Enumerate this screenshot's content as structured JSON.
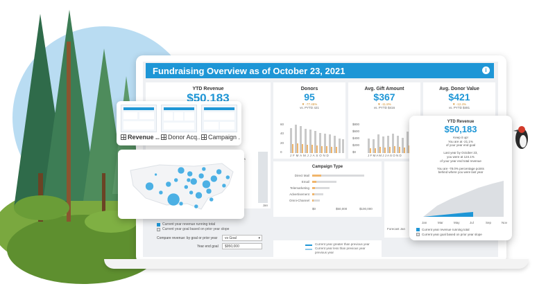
{
  "dashboard": {
    "title": "Fundraising Overview as of October 23, 2021",
    "ytd_revenue": {
      "title": "YTD Revenue",
      "value": "$50,183",
      "note_line1": "You are -78.0% percentage points",
      "note_line2": "behind where you were last year"
    },
    "donors": {
      "title": "Donors",
      "value": "95",
      "change": "▼ -77.45%",
      "vs": "vs. PYTD 421",
      "yticks": [
        "60",
        "40",
        "20",
        "0"
      ],
      "months": "JFMAMJJASOND",
      "bars": [
        52,
        58,
        55,
        50,
        48,
        45,
        42,
        40,
        38,
        35,
        30,
        28
      ]
    },
    "avg_gift": {
      "title": "Avg. Gift Amount",
      "value": "$367",
      "change": "▼ -11.8%",
      "vs": "vs. PYTD $416",
      "yticks": [
        "$800",
        "$600",
        "$400",
        "$200",
        "$0"
      ],
      "months": "J F M A M J J A S O N D",
      "bars": [
        30,
        28,
        38,
        34,
        36,
        40,
        35,
        32,
        44,
        38,
        42,
        48
      ]
    },
    "avg_donor": {
      "title": "Avg. Donor Value",
      "value": "$421",
      "change": "▼ -12.4%",
      "vs": "vs. PYTD $481"
    },
    "campaign": {
      "title": "Campaign Type",
      "rows": [
        {
          "label": "Direct Mail",
          "value": 85
        },
        {
          "label": "Email",
          "value": 40
        },
        {
          "label": "Telemarketing",
          "value": 28
        },
        {
          "label": "Advertisement",
          "value": 18
        },
        {
          "label": "Omni-Channel",
          "value": 12
        }
      ],
      "xticks": [
        "$0",
        "$50,000",
        "$100,000"
      ]
    },
    "legend": {
      "item1": "Current year revenue running total",
      "item2": "Current year goal based on prior year slope"
    },
    "controls": {
      "compare_label": "Compare revenue: by goal or prior year",
      "compare_value": "vs Goal",
      "year_goal_label": "Year end goal",
      "year_goal_value": "$950,000"
    },
    "bottom_legend": {
      "line1": "Current year greater than previous year",
      "line2": "Current year less than previous year",
      "line3": "previous year"
    },
    "axis_end": "Jan",
    "axis_small": "Forecast Jan"
  },
  "thumbnails": [
    {
      "label": "Revenue ..."
    },
    {
      "label": "Donor Acq..."
    },
    {
      "label": "Campaign ..."
    }
  ],
  "map": {
    "points": [
      {
        "x": 0.44,
        "y": 0.72,
        "r": 9
      },
      {
        "x": 0.25,
        "y": 0.53,
        "r": 6
      },
      {
        "x": 0.4,
        "y": 0.5,
        "r": 4
      },
      {
        "x": 0.5,
        "y": 0.3,
        "r": 5
      },
      {
        "x": 0.57,
        "y": 0.35,
        "r": 4
      },
      {
        "x": 0.54,
        "y": 0.54,
        "r": 3
      },
      {
        "x": 0.6,
        "y": 0.46,
        "r": 5
      },
      {
        "x": 0.66,
        "y": 0.38,
        "r": 4
      },
      {
        "x": 0.7,
        "y": 0.5,
        "r": 6
      },
      {
        "x": 0.76,
        "y": 0.42,
        "r": 5
      },
      {
        "x": 0.8,
        "y": 0.32,
        "r": 4
      },
      {
        "x": 0.72,
        "y": 0.6,
        "r": 4
      },
      {
        "x": 0.64,
        "y": 0.66,
        "r": 5
      },
      {
        "x": 0.58,
        "y": 0.62,
        "r": 3
      },
      {
        "x": 0.84,
        "y": 0.52,
        "r": 3
      },
      {
        "x": 0.62,
        "y": 0.82,
        "r": 3
      },
      {
        "x": 0.5,
        "y": 0.78,
        "r": 3
      },
      {
        "x": 0.34,
        "y": 0.62,
        "r": 3
      },
      {
        "x": 0.3,
        "y": 0.36,
        "r": 2
      },
      {
        "x": 0.46,
        "y": 0.44,
        "r": 3
      },
      {
        "x": 0.68,
        "y": 0.28,
        "r": 3
      },
      {
        "x": 0.87,
        "y": 0.4,
        "r": 3
      },
      {
        "x": 0.74,
        "y": 0.72,
        "r": 3
      },
      {
        "x": 0.56,
        "y": 0.44,
        "r": 3
      }
    ]
  },
  "revenue_popup": {
    "title": "YTD Revenue",
    "value": "$50,183",
    "lines": [
      "Keep it up!",
      "You are at -21.1%",
      "of your year end goal",
      "",
      "Last year by October 23,",
      "you were at 124.1%",
      "of your year end total revenue",
      "",
      "You are -78.0% percentage points",
      "behind where you were last year"
    ],
    "xticks": [
      "Jan",
      "Mar",
      "May",
      "Jul",
      "Sep",
      "Nov"
    ],
    "legend1": "Current year revenue running total",
    "legend2": "Current year goal based on prior year slope"
  },
  "colors": {
    "accent": "#1e96d6",
    "prior_year": "#c9c9c9",
    "current_year": "#f0b56b",
    "goal_area": "#d9dee4"
  }
}
